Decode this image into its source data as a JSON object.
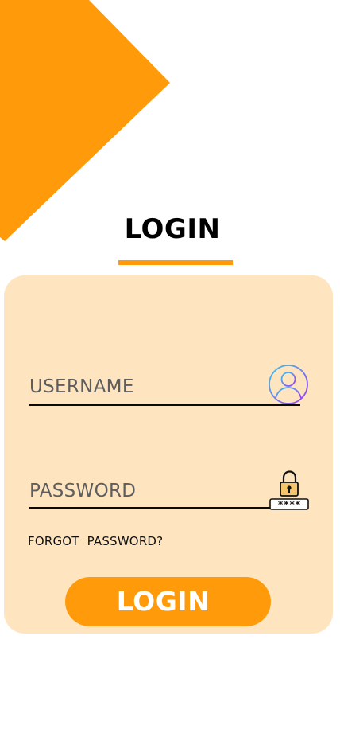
{
  "header": {
    "title": "LOGIN"
  },
  "form": {
    "username_label": "USERNAME",
    "password_label": "PASSWORD",
    "password_icon_text": "****",
    "forgot_password": "FORGOT  PASSWORD?",
    "submit_label": "LOGIN"
  },
  "icons": {
    "user": "user-avatar-icon",
    "password": "padlock-password-icon",
    "decoration": "orange-diamond-shape"
  },
  "colors": {
    "accent": "#ff9b0a",
    "card_background": "#fee5c0",
    "text": "#000000",
    "field_label": "#5e5e5e",
    "button_text": "#ffffff",
    "user_icon_gradient_start": "#36c4f0",
    "user_icon_gradient_end": "#a23cf0",
    "lock_body": "#f6c46a"
  }
}
